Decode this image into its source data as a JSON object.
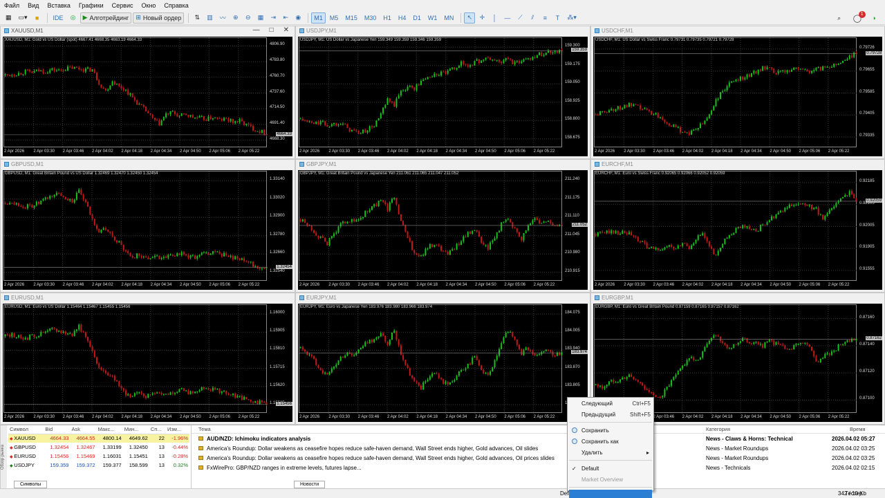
{
  "menu": [
    "Файл",
    "Вид",
    "Вставка",
    "Графики",
    "Сервис",
    "Окно",
    "Справка"
  ],
  "toolbar": {
    "ide": "IDE",
    "algo": "Алготрейдинг",
    "new_order": "Новый ордер",
    "timeframes": [
      "M1",
      "M5",
      "M15",
      "M30",
      "H1",
      "H4",
      "D1",
      "W1",
      "MN"
    ],
    "active_timeframe": "M1",
    "notifications_count": "1"
  },
  "charts": [
    {
      "title": "XAUUSD,M1",
      "info": "XAUUSD, M1:  Gold vs US Dollar (spot)  4667.41 4668.35 4663.19 4664.33",
      "yticks": [
        "4806.90",
        "4783.80",
        "4760.70",
        "4737.60",
        "4714.50",
        "4691.40",
        "4668.30"
      ],
      "price_tag": "4664.33",
      "active": true,
      "x_labels": [
        "2 Apr 2026",
        "2 Apr 03:30",
        "2 Apr 03:46",
        "2 Apr 04:02",
        "2 Apr 04:18",
        "2 Apr 04:34",
        "2 Apr 04:50",
        "2 Apr 05:06",
        "2 Apr 05:22"
      ],
      "shape": [
        0.72,
        0.73,
        0.74,
        0.76,
        0.75,
        0.77,
        0.76,
        0.78,
        0.77,
        0.79,
        0.8,
        0.79,
        0.78,
        0.78,
        0.64,
        0.55,
        0.66,
        0.6,
        0.56,
        0.48,
        0.4,
        0.34,
        0.25,
        0.2,
        0.3,
        0.32,
        0.28,
        0.3,
        0.27,
        0.26,
        0.25,
        0.27,
        0.24,
        0.25,
        0.22,
        0.23,
        0.19,
        0.15,
        0.12,
        0.1
      ]
    },
    {
      "title": "USDJPY,M1",
      "info": "USDJPY, M1:  US Dollar vs Japanese Yen  159.349 159.359 159.346 159.359",
      "yticks": [
        "159.300",
        "159.175",
        "159.050",
        "158.925",
        "158.800",
        "158.675"
      ],
      "price_tag": "159.359",
      "active": false,
      "x_labels": [
        "2 Apr 2026",
        "2 Apr 03:30",
        "2 Apr 03:46",
        "2 Apr 04:02",
        "2 Apr 04:18",
        "2 Apr 04:34",
        "2 Apr 04:50",
        "2 Apr 05:06",
        "2 Apr 05:22"
      ],
      "shape": [
        0.25,
        0.22,
        0.2,
        0.22,
        0.18,
        0.2,
        0.22,
        0.15,
        0.12,
        0.1,
        0.14,
        0.18,
        0.3,
        0.45,
        0.4,
        0.55,
        0.6,
        0.58,
        0.65,
        0.7,
        0.72,
        0.74,
        0.75,
        0.8,
        0.85,
        0.82,
        0.86,
        0.88,
        0.9,
        0.88,
        0.86,
        0.9,
        0.84,
        0.88,
        0.9,
        0.93,
        0.95,
        0.97,
        0.98,
        0.99
      ]
    },
    {
      "title": "USDCHF,M1",
      "info": "USDCHF, M1:  US Dollar vs Swiss Franc  0.79731 0.79735 0.79721 0.79728",
      "yticks": [
        "0.79726",
        "0.79655",
        "0.79585",
        "0.79405",
        "0.79335"
      ],
      "price_tag": "0.79728",
      "active": false,
      "x_labels": [
        "2 Apr 2026",
        "2 Apr 03:30",
        "2 Apr 03:46",
        "2 Apr 04:02",
        "2 Apr 04:18",
        "2 Apr 04:34",
        "2 Apr 04:50",
        "2 Apr 05:06",
        "2 Apr 05:22"
      ],
      "shape": [
        0.3,
        0.32,
        0.35,
        0.36,
        0.38,
        0.4,
        0.38,
        0.36,
        0.33,
        0.3,
        0.26,
        0.2,
        0.15,
        0.12,
        0.1,
        0.14,
        0.2,
        0.3,
        0.45,
        0.55,
        0.62,
        0.68,
        0.7,
        0.72,
        0.76,
        0.8,
        0.78,
        0.74,
        0.76,
        0.78,
        0.8,
        0.78,
        0.76,
        0.78,
        0.8,
        0.82,
        0.84,
        0.88,
        0.92,
        0.95
      ]
    },
    {
      "title": "GBPUSD,M1",
      "info": "GBPUSD, M1:  Great Britain Pound vs US Dollar  1.32469 1.32470 1.32450 1.32454",
      "yticks": [
        "1.33140",
        "1.33020",
        "1.32900",
        "1.32780",
        "1.32660",
        "1.32540"
      ],
      "price_tag": "1.32454",
      "active": false,
      "x_labels": [
        "2 Apr 2026",
        "2 Apr 03:30",
        "2 Apr 03:46",
        "2 Apr 04:02",
        "2 Apr 04:18",
        "2 Apr 04:34",
        "2 Apr 04:50",
        "2 Apr 05:06",
        "2 Apr 05:22"
      ],
      "shape": [
        0.78,
        0.8,
        0.76,
        0.74,
        0.75,
        0.78,
        0.82,
        0.86,
        0.88,
        0.84,
        0.8,
        0.9,
        0.78,
        0.6,
        0.48,
        0.5,
        0.42,
        0.35,
        0.25,
        0.2,
        0.24,
        0.18,
        0.22,
        0.2,
        0.21,
        0.22,
        0.24,
        0.22,
        0.2,
        0.22,
        0.24,
        0.26,
        0.24,
        0.22,
        0.2,
        0.18,
        0.15,
        0.12,
        0.1,
        0.08
      ]
    },
    {
      "title": "GBPJPY,M1",
      "info": "GBPJPY, M1:  Great Britain Pound vs Japanese Yen  211.061 211.065 211.047 211.052",
      "yticks": [
        "211.240",
        "211.175",
        "211.110",
        "211.045",
        "210.980",
        "210.915"
      ],
      "price_tag": "211.052",
      "active": false,
      "x_labels": [
        "2 Apr 2026",
        "2 Apr 03:30",
        "2 Apr 03:46",
        "2 Apr 04:02",
        "2 Apr 04:18",
        "2 Apr 04:34",
        "2 Apr 04:50",
        "2 Apr 05:06",
        "2 Apr 05:22"
      ],
      "shape": [
        0.6,
        0.55,
        0.48,
        0.4,
        0.35,
        0.45,
        0.55,
        0.6,
        0.58,
        0.62,
        0.7,
        0.75,
        0.8,
        0.72,
        0.85,
        0.6,
        0.4,
        0.25,
        0.2,
        0.3,
        0.35,
        0.28,
        0.24,
        0.3,
        0.38,
        0.45,
        0.5,
        0.35,
        0.3,
        0.42,
        0.55,
        0.6,
        0.5,
        0.4,
        0.55,
        0.62,
        0.55,
        0.58,
        0.55,
        0.52
      ]
    },
    {
      "title": "EURCHF,M1",
      "info": "EURCHF, M1:  Euro vs Swiss Franc  0.92065 0.92066 0.92052 0.92059",
      "yticks": [
        "0.92185",
        "0.92105",
        "0.92005",
        "0.91905",
        "0.91555"
      ],
      "price_tag": "0.92059",
      "active": false,
      "x_labels": [
        "2 Apr 2026",
        "2 Apr 03:30",
        "2 Apr 03:46",
        "2 Apr 04:02",
        "2 Apr 04:18",
        "2 Apr 04:34",
        "2 Apr 04:50",
        "2 Apr 05:06",
        "2 Apr 05:22"
      ],
      "shape": [
        0.45,
        0.46,
        0.48,
        0.47,
        0.46,
        0.45,
        0.4,
        0.35,
        0.3,
        0.28,
        0.3,
        0.32,
        0.28,
        0.35,
        0.3,
        0.4,
        0.45,
        0.3,
        0.2,
        0.35,
        0.45,
        0.5,
        0.55,
        0.52,
        0.48,
        0.55,
        0.6,
        0.65,
        0.7,
        0.75,
        0.78,
        0.76,
        0.74,
        0.72,
        0.6,
        0.7,
        0.8,
        0.85,
        0.9,
        0.82
      ]
    },
    {
      "title": "EURUSD,M1",
      "info": "EURUSD, M1:  Euro vs US Dollar  1.15464 1.15467 1.15455 1.15456",
      "yticks": [
        "1.16000",
        "1.15905",
        "1.15810",
        "1.15715",
        "1.15620",
        "1.15525"
      ],
      "price_tag": "1.15456",
      "active": false,
      "x_labels": [
        "2 Apr 2026",
        "2 Apr 03:30",
        "2 Apr 03:46",
        "2 Apr 04:02",
        "2 Apr 04:18",
        "2 Apr 04:34",
        "2 Apr 04:50",
        "2 Apr 05:06",
        "2 Apr 05:22"
      ],
      "shape": [
        0.78,
        0.8,
        0.77,
        0.76,
        0.78,
        0.8,
        0.82,
        0.86,
        0.84,
        0.82,
        0.8,
        0.9,
        0.76,
        0.6,
        0.45,
        0.4,
        0.34,
        0.25,
        0.16,
        0.14,
        0.18,
        0.12,
        0.16,
        0.18,
        0.15,
        0.18,
        0.2,
        0.18,
        0.16,
        0.2,
        0.22,
        0.2,
        0.18,
        0.16,
        0.14,
        0.12,
        0.1,
        0.08,
        0.06,
        0.05
      ]
    },
    {
      "title": "EURJPY,M1",
      "info": "EURJPY, M1:  Euro vs Japanese Yen  183.976 183.980 183.966 183.974",
      "yticks": [
        "184.075",
        "184.005",
        "183.940",
        "183.870",
        "183.805",
        "183.735"
      ],
      "price_tag": "183.974",
      "active": false,
      "x_labels": [
        "2 Apr 2026",
        "2 Apr 03:30",
        "2 Apr 03:46",
        "2 Apr 04:02",
        "2 Apr 04:18",
        "2 Apr 04:34",
        "2 Apr 04:50",
        "2 Apr 05:06",
        "2 Apr 05:22"
      ],
      "shape": [
        0.65,
        0.6,
        0.52,
        0.42,
        0.35,
        0.45,
        0.55,
        0.6,
        0.58,
        0.65,
        0.72,
        0.75,
        0.8,
        0.7,
        0.85,
        0.6,
        0.42,
        0.28,
        0.22,
        0.32,
        0.38,
        0.3,
        0.25,
        0.32,
        0.4,
        0.48,
        0.55,
        0.4,
        0.35,
        0.5,
        0.7,
        0.85,
        0.75,
        0.6,
        0.65,
        0.55,
        0.6,
        0.62,
        0.58,
        0.6
      ]
    },
    {
      "title": "EURGBP,M1",
      "info": "EURGBP, M1:  Euro vs Great Britain Pound  0.87159 0.87165 0.87157 0.87162",
      "yticks": [
        "0.87160",
        "0.87140",
        "0.87120",
        "0.87100"
      ],
      "price_tag": "0.87162",
      "active": false,
      "x_labels": [
        "2 Apr 2026",
        "2 Apr 03:30",
        "2 Apr 03:46",
        "2 Apr 04:02",
        "2 Apr 04:18",
        "2 Apr 04:34",
        "2 Apr 04:50",
        "2 Apr 05:06",
        "2 Apr 05:22"
      ],
      "shape": [
        0.25,
        0.22,
        0.28,
        0.3,
        0.32,
        0.35,
        0.3,
        0.25,
        0.18,
        0.1,
        0.15,
        0.25,
        0.35,
        0.45,
        0.55,
        0.5,
        0.6,
        0.75,
        0.8,
        0.72,
        0.65,
        0.7,
        0.75,
        0.72,
        0.7,
        0.68,
        0.72,
        0.7,
        0.66,
        0.64,
        0.68,
        0.72,
        0.66,
        0.5,
        0.55,
        0.6,
        0.65,
        0.7,
        0.72,
        0.74
      ]
    }
  ],
  "market_watch": {
    "columns": [
      "Символ",
      "Bid",
      "Ask",
      "Макс...",
      "Мин...",
      "Сп...",
      "Изм..."
    ],
    "rows": [
      {
        "symbol": "XAUUSD",
        "bid": "4664.33",
        "ask": "4664.55",
        "high": "4800.14",
        "low": "4649.62",
        "spread": "22",
        "change": "-1.96%",
        "change_dir": "neg"
      },
      {
        "symbol": "GBPUSD",
        "bid": "1.32454",
        "ask": "1.32467",
        "high": "1.33199",
        "low": "1.32450",
        "spread": "13",
        "change": "-0.44%",
        "change_dir": "neg"
      },
      {
        "symbol": "EURUSD",
        "bid": "1.15456",
        "ask": "1.15469",
        "high": "1.16031",
        "low": "1.15451",
        "spread": "13",
        "change": "-0.28%",
        "change_dir": "neg"
      },
      {
        "symbol": "USDJPY",
        "bid": "159.359",
        "ask": "159.372",
        "high": "159.377",
        "low": "158.599",
        "spread": "13",
        "change": "0.32%",
        "change_dir": "pos"
      }
    ],
    "tab": "Символы",
    "side_label": "Обзор рынка"
  },
  "news": {
    "columns": [
      "Тема",
      "Категория",
      "Время"
    ],
    "rows": [
      {
        "title": "AUD/NZD: Ichimoku indicators analysis",
        "category": "News - Claws & Horns: Technical",
        "time": "2026.04.02 05:27"
      },
      {
        "title": "America's Roundup: Dollar weakens as ceasefire hopes reduce safe-haven demand, Wall Street ends higher, Gold advances, Oil slides",
        "category": "News - Market Roundups",
        "time": "2026.04.02 03:25"
      },
      {
        "title": "America's Roundup: Dollar weakens as ceasefire hopes reduce safe-haven demand, Wall Street ends higher, Gold advances, Oil prices slides",
        "category": "News - Market Roundups",
        "time": "2026.04.02 03:25"
      },
      {
        "title": "FxWirePro: GBP/NZD ranges in extreme levels, futures lapse...",
        "category": "News - Technicals",
        "time": "2026.04.02 02:15"
      }
    ],
    "tab": "Новости",
    "side_label": "Новости"
  },
  "context_menu": {
    "items": [
      {
        "label": "Следующий",
        "shortcut": "Ctrl+F5",
        "state": "normal",
        "icon": ""
      },
      {
        "label": "Предыдущий",
        "shortcut": "Shift+F5",
        "state": "normal",
        "icon": ""
      },
      {
        "label": "divider"
      },
      {
        "label": "Сохранить",
        "shortcut": "",
        "state": "normal",
        "icon": "save-icon"
      },
      {
        "label": "Сохранить как",
        "shortcut": "",
        "state": "normal",
        "icon": "save-as-icon"
      },
      {
        "label": "Удалить",
        "shortcut": "",
        "state": "submenu",
        "icon": ""
      },
      {
        "label": "divider"
      },
      {
        "label": "Default",
        "shortcut": "",
        "state": "checked",
        "icon": ""
      },
      {
        "label": "Market Overview",
        "shortcut": "",
        "state": "disabled",
        "icon": ""
      },
      {
        "label": "divider"
      },
      {
        "label": "",
        "shortcut": "",
        "state": "highlight",
        "icon": ""
      }
    ]
  },
  "status": {
    "profile": "Default",
    "tester": "Тестер",
    "traffic": "342 / 10 Kb"
  },
  "colors": {
    "bull": "#19c219",
    "bear": "#c21919",
    "accent": "#2a7fd4"
  }
}
